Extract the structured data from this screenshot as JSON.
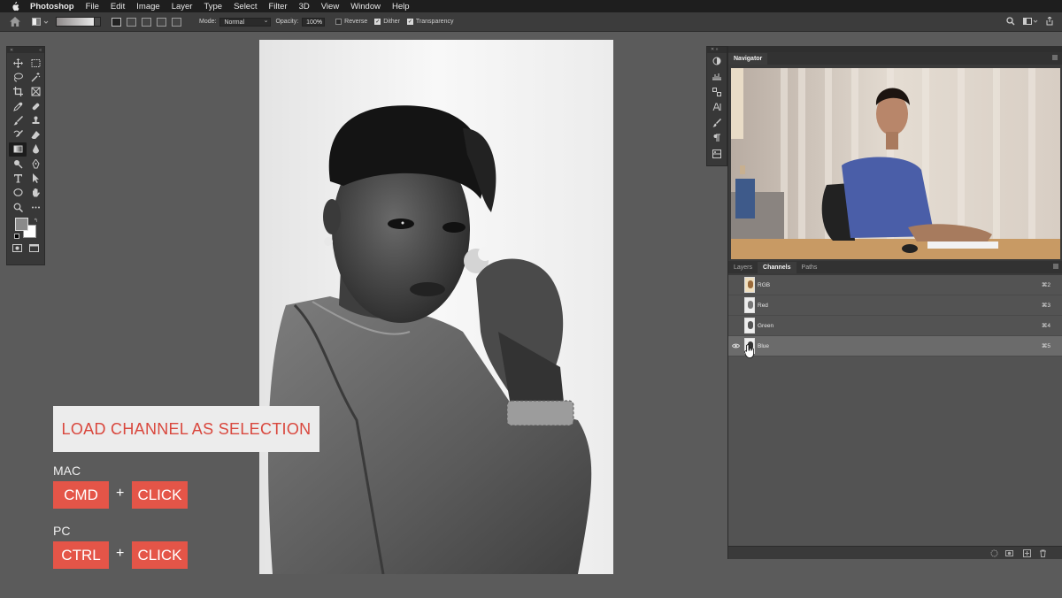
{
  "menubar": {
    "app": "Photoshop",
    "items": [
      "File",
      "Edit",
      "Image",
      "Layer",
      "Type",
      "Select",
      "Filter",
      "3D",
      "View",
      "Window",
      "Help"
    ]
  },
  "options": {
    "mode_label": "Mode:",
    "mode_value": "Normal",
    "opacity_label": "Opacity:",
    "opacity_value": "100%",
    "reverse_label": "Reverse",
    "dither_label": "Dither",
    "transparency_label": "Transparency",
    "reverse_checked": false,
    "dither_checked": true,
    "transparency_checked": true
  },
  "navigator": {
    "tab": "Navigator"
  },
  "channels_panel": {
    "tabs": [
      "Layers",
      "Channels",
      "Paths"
    ],
    "active_tab": "Channels",
    "rows": [
      {
        "name": "RGB",
        "shortcut": "⌘2",
        "visible": false,
        "selected": false
      },
      {
        "name": "Red",
        "shortcut": "⌘3",
        "visible": false,
        "selected": false
      },
      {
        "name": "Green",
        "shortcut": "⌘4",
        "visible": false,
        "selected": false
      },
      {
        "name": "Blue",
        "shortcut": "⌘5",
        "visible": true,
        "selected": true
      }
    ]
  },
  "overlay": {
    "title": "LOAD CHANNEL AS SELECTION",
    "mac_label": "MAC",
    "mac_key1": "CMD",
    "mac_key2": "CLICK",
    "pc_label": "PC",
    "pc_key1": "CTRL",
    "pc_key2": "CLICK",
    "plus": "+"
  },
  "colors": {
    "accent_red": "#e45548",
    "title_red": "#d9473d",
    "foreground_swatch": "#8a8a8a",
    "background_swatch": "#ffffff"
  }
}
